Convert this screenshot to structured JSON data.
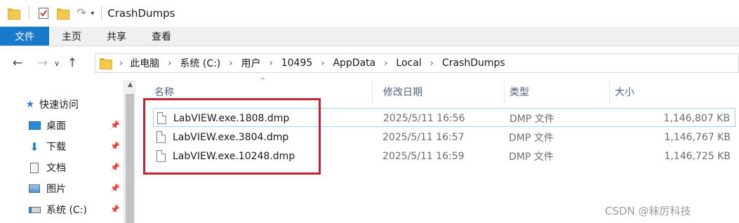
{
  "window": {
    "title": "CrashDumps"
  },
  "quick_access_toolbar": {
    "icons": [
      "folder-icon",
      "properties-check-icon",
      "new-folder-icon",
      "undo-icon",
      "customize-dropdown-icon"
    ]
  },
  "ribbon": {
    "tabs": [
      {
        "label": "文件",
        "active": true
      },
      {
        "label": "主页"
      },
      {
        "label": "共享"
      },
      {
        "label": "查看"
      }
    ],
    "accent": "#1979ca"
  },
  "address_bar": {
    "crumbs": [
      "此电脑",
      "系统 (C:)",
      "用户",
      "10495",
      "AppData",
      "Local",
      "CrashDumps"
    ]
  },
  "sidebar": {
    "items": [
      {
        "label": "快速访问",
        "icon": "star-icon"
      },
      {
        "label": "桌面",
        "icon": "desktop-icon",
        "pinned": true
      },
      {
        "label": "下载",
        "icon": "download-icon",
        "pinned": true
      },
      {
        "label": "文档",
        "icon": "document-icon",
        "pinned": true
      },
      {
        "label": "图片",
        "icon": "picture-icon",
        "pinned": true
      },
      {
        "label": "系统 (C:)",
        "icon": "drive-icon",
        "pinned": true
      }
    ]
  },
  "file_list": {
    "columns": {
      "name": "名称",
      "modified": "修改日期",
      "type": "类型",
      "size": "大小"
    },
    "sort_indicator": "^",
    "rows": [
      {
        "name": "LabVIEW.exe.1808.dmp",
        "modified": "2025/5/11 16:56",
        "type": "DMP 文件",
        "size": "1,146,807 KB",
        "selected": true
      },
      {
        "name": "LabVIEW.exe.3804.dmp",
        "modified": "2025/5/11 16:57",
        "type": "DMP 文件",
        "size": "1,146,767 KB"
      },
      {
        "name": "LabVIEW.exe.10248.dmp",
        "modified": "2025/5/11 16:59",
        "type": "DMP 文件",
        "size": "1,146,725 KB"
      }
    ]
  },
  "highlight_color": "#c8202d",
  "watermark": "CSDN @秣厉科技"
}
